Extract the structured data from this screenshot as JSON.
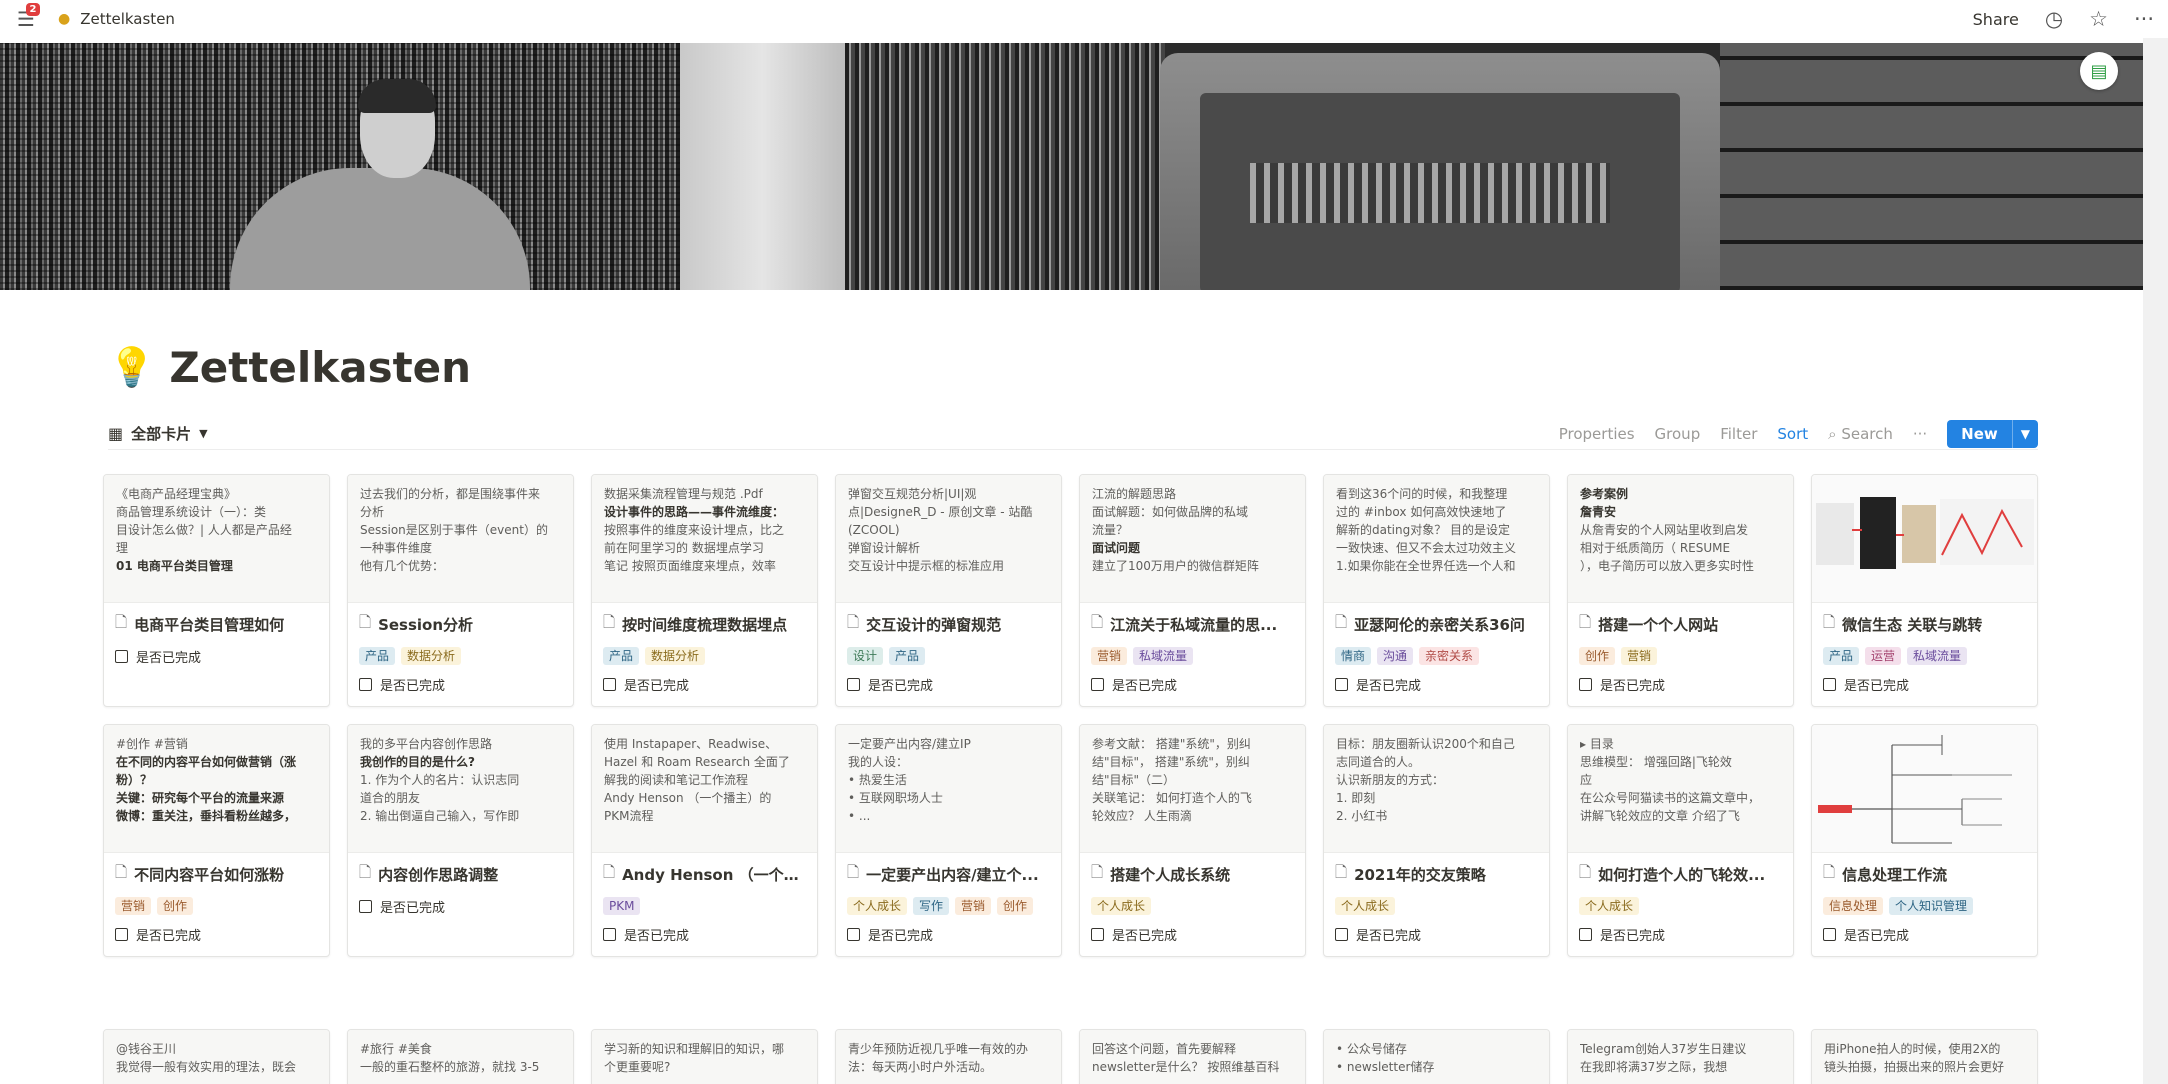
{
  "topbar": {
    "menu_badge": "2",
    "breadcrumb_title": "Zettelkasten",
    "share_label": "Share"
  },
  "page": {
    "title": "Zettelkasten"
  },
  "view": {
    "name": "全部卡片",
    "actions": {
      "properties": "Properties",
      "group": "Group",
      "filter": "Filter",
      "sort": "Sort",
      "search": "Search",
      "more": "···",
      "new": "New"
    }
  },
  "tag_colors": {
    "orange": {
      "bg": "#fbecdd",
      "fg": "#9a5b2e"
    },
    "blue": {
      "bg": "#ddebf1",
      "fg": "#2e6584"
    },
    "green": {
      "bg": "#ddedea",
      "fg": "#3e7a58"
    },
    "yellow": {
      "bg": "#fbf3db",
      "fg": "#8a6b1e"
    },
    "purple": {
      "bg": "#eae4f2",
      "fg": "#6a4c9c"
    },
    "pink": {
      "bg": "#f4dfeb",
      "fg": "#a4436f"
    },
    "red": {
      "bg": "#fbe4e4",
      "fg": "#b04a46"
    },
    "gray": {
      "bg": "#ebeced",
      "fg": "#5f5e5b"
    }
  },
  "checkbox_label": "是否已完成",
  "cards": [
    {
      "preview": [
        {
          "t": "《电商产品经理宝典》",
          "b": false
        },
        {
          "t": "商品管理系统设计（一）：类",
          "b": false
        },
        {
          "t": "目设计怎么做？| 人人都是产品经",
          "b": false
        },
        {
          "t": "理",
          "b": false
        },
        {
          "t": "01 电商平台类目管理",
          "b": true
        }
      ],
      "title": "电商平台类目管理如何",
      "tags": []
    },
    {
      "preview": [
        {
          "t": "过去我们的分析，都是围绕事件来",
          "b": false
        },
        {
          "t": "分析",
          "b": false
        },
        {
          "t": "Session是区别于事件（event）的",
          "b": false
        },
        {
          "t": "一种事件维度",
          "b": false
        },
        {
          "t": "他有几个优势：",
          "b": false
        }
      ],
      "title": "Session分析",
      "tags": [
        {
          "label": "产品",
          "color": "blue"
        },
        {
          "label": "数据分析",
          "color": "yellow"
        }
      ]
    },
    {
      "preview": [
        {
          "t": "数据采集流程管理与规范 .Pdf",
          "b": false
        },
        {
          "t": "设计事件的思路——事件流维度：",
          "b": true
        },
        {
          "t": "按照事件的维度来设计埋点，比之",
          "b": false
        },
        {
          "t": "前在阿里学习的 数据埋点学习",
          "b": false
        },
        {
          "t": "笔记 按照页面维度来埋点，效率",
          "b": false
        }
      ],
      "title": "按时间维度梳理数据埋点",
      "tags": [
        {
          "label": "产品",
          "color": "blue"
        },
        {
          "label": "数据分析",
          "color": "yellow"
        }
      ]
    },
    {
      "preview": [
        {
          "t": "弹窗交互规范分析|UI|观",
          "b": false
        },
        {
          "t": "点|DesigneR_D - 原创文章 - 站酷",
          "b": false
        },
        {
          "t": "(ZCOOL)",
          "b": false
        },
        {
          "t": "弹窗设计解析",
          "b": false
        },
        {
          "t": "交互设计中提示框的标准应用",
          "b": false
        }
      ],
      "title": "交互设计的弹窗规范",
      "tags": [
        {
          "label": "设计",
          "color": "green"
        },
        {
          "label": "产品",
          "color": "blue"
        }
      ]
    },
    {
      "preview": [
        {
          "t": "江流的解题思路",
          "b": false
        },
        {
          "t": "面试解题：如何做品牌的私域",
          "b": false
        },
        {
          "t": "流量？",
          "b": false
        },
        {
          "t": "面试问题",
          "b": true
        },
        {
          "t": "建立了100万用户的微信群矩阵",
          "b": false
        }
      ],
      "title": "江流关于私域流量的思...",
      "tags": [
        {
          "label": "营销",
          "color": "orange"
        },
        {
          "label": "私域流量",
          "color": "purple"
        }
      ]
    },
    {
      "preview": [
        {
          "t": "看到这36个问的时候，和我整理",
          "b": false
        },
        {
          "t": "过的 #inbox 如何高效快速地了",
          "b": false
        },
        {
          "t": "解新的dating对象？ 目的是设定",
          "b": false
        },
        {
          "t": "一致快速、但又不会太过功效主义",
          "b": false
        },
        {
          "t": "1.如果你能在全世界任选一个人和",
          "b": false
        }
      ],
      "title": "亚瑟阿伦的亲密关系36问",
      "tags": [
        {
          "label": "情商",
          "color": "blue"
        },
        {
          "label": "沟通",
          "color": "purple"
        },
        {
          "label": "亲密关系",
          "color": "red"
        }
      ]
    },
    {
      "preview": [
        {
          "t": "参考案例",
          "b": true
        },
        {
          "t": "詹青安",
          "b": true
        },
        {
          "t": "从詹青安的个人网站里收到启发",
          "b": false
        },
        {
          "t": "相对于纸质简历（ RESUME",
          "b": false
        },
        {
          "t": "），电子简历可以放入更多实时性",
          "b": false
        }
      ],
      "title": "搭建一个个人网站",
      "tags": [
        {
          "label": "创作",
          "color": "orange"
        },
        {
          "label": "营销",
          "color": "yellow"
        }
      ]
    },
    {
      "preview_image": "phone-screens",
      "title": "微信生态 关联与跳转",
      "tags": [
        {
          "label": "产品",
          "color": "blue"
        },
        {
          "label": "运营",
          "color": "pink"
        },
        {
          "label": "私域流量",
          "color": "purple"
        }
      ]
    },
    {
      "preview": [
        {
          "t": "#创作 #营销",
          "b": false
        },
        {
          "t": "在不同的内容平台如何做营销（涨",
          "b": true
        },
        {
          "t": "粉）？",
          "b": true
        },
        {
          "t": "关键：研究每个平台的流量来源",
          "b": true
        },
        {
          "t": "微博：重关注，垂抖看粉丝越多，",
          "b": true
        }
      ],
      "title": "不同内容平台如何涨粉",
      "tags": [
        {
          "label": "营销",
          "color": "orange"
        },
        {
          "label": "创作",
          "color": "orange"
        }
      ]
    },
    {
      "preview": [
        {
          "t": "我的多平台内容创作思路",
          "b": false
        },
        {
          "t": "我创作的目的是什么?",
          "b": true
        },
        {
          "t": "  1.   作为个人的名片：认识志同",
          "b": false
        },
        {
          "t": "       道合的朋友",
          "b": false
        },
        {
          "t": "  2.   输出倒逼自己输入，写作即",
          "b": false
        }
      ],
      "title": "内容创作思路调整",
      "tags": []
    },
    {
      "preview": [
        {
          "t": "使用 Instapaper、Readwise、",
          "b": false
        },
        {
          "t": "Hazel 和 Roam Research 全面了",
          "b": false
        },
        {
          "t": "解我的阅读和笔记工作流程",
          "b": false
        },
        {
          "t": "Andy Henson （一个播主）的",
          "b": false
        },
        {
          "t": "PKM流程",
          "b": false
        }
      ],
      "title": "Andy Henson （一个播...",
      "tags": [
        {
          "label": "PKM",
          "color": "purple"
        }
      ]
    },
    {
      "preview": [
        {
          "t": "一定要产出内容/建立IP",
          "b": false
        },
        {
          "t": "我的人设：",
          "b": false
        },
        {
          "t": "  •  热爱生活",
          "b": false
        },
        {
          "t": "  •  互联网职场人士",
          "b": false
        },
        {
          "t": "  •  ...",
          "b": false
        }
      ],
      "title": "一定要产出内容/建立个...",
      "tags": [
        {
          "label": "个人成长",
          "color": "yellow"
        },
        {
          "label": "写作",
          "color": "blue"
        },
        {
          "label": "营销",
          "color": "orange"
        },
        {
          "label": "创作",
          "color": "orange"
        }
      ]
    },
    {
      "preview": [
        {
          "t": "参考文献： 搭建\"系统\"，别纠",
          "b": false
        },
        {
          "t": "结\"目标\"， 搭建\"系统\"，别纠",
          "b": false
        },
        {
          "t": "结\"目标\"（二）",
          "b": false
        },
        {
          "t": "关联笔记： 如何打造个人的飞",
          "b": false
        },
        {
          "t": "轮效应？  人生雨滴",
          "b": false
        }
      ],
      "title": "搭建个人成长系统",
      "tags": [
        {
          "label": "个人成长",
          "color": "yellow"
        }
      ]
    },
    {
      "preview": [
        {
          "t": "目标：朋友圈新认识200个和自己",
          "b": false
        },
        {
          "t": "志同道合的人。",
          "b": false
        },
        {
          "t": "认识新朋友的方式：",
          "b": false
        },
        {
          "t": "  1.   即刻",
          "b": false
        },
        {
          "t": "  2.   小红书",
          "b": false
        }
      ],
      "title": "2021年的交友策略",
      "tags": [
        {
          "label": "个人成长",
          "color": "yellow"
        }
      ]
    },
    {
      "preview": [
        {
          "t": "  ▸  目录",
          "b": false
        },
        {
          "t": "思维模型：  增强回路|飞轮效",
          "b": false
        },
        {
          "t": "应",
          "b": false
        },
        {
          "t": "在公众号阿猫读书的这篇文章中，",
          "b": false
        },
        {
          "t": " 讲解飞轮效应的文章 介绍了飞",
          "b": false
        }
      ],
      "title": "如何打造个人的飞轮效...",
      "tags": [
        {
          "label": "个人成长",
          "color": "yellow"
        }
      ]
    },
    {
      "preview_image": "mindmap",
      "title": "信息处理工作流",
      "tags": [
        {
          "label": "信息处理",
          "color": "orange"
        },
        {
          "label": "个人知识管理",
          "color": "blue"
        }
      ]
    }
  ],
  "row3_previews": [
    [
      "@钱谷王川",
      "我觉得一般有效实用的理法，既会"
    ],
    [
      "#旅行 #美食",
      "一般的重石整杯的旅游，就找 3-5"
    ],
    [
      "学习新的知识和理解旧的知识，哪",
      "个更重要呢?"
    ],
    [
      "青少年预防近视几乎唯一有效的办",
      "法：每天两小时户外活动。"
    ],
    [
      "回答这个问题，首先要解释",
      "newsletter是什么？ 按照维基百科"
    ],
    [
      "  •  公众号储存",
      "  •  newsletter储存"
    ],
    [
      "Telegram创始人37岁生日建议",
      "在我即将满37岁之际，我想"
    ],
    [
      "用iPhone拍人的时候，使用2X的",
      "镜头拍摄，拍摄出来的照片会更好"
    ]
  ]
}
